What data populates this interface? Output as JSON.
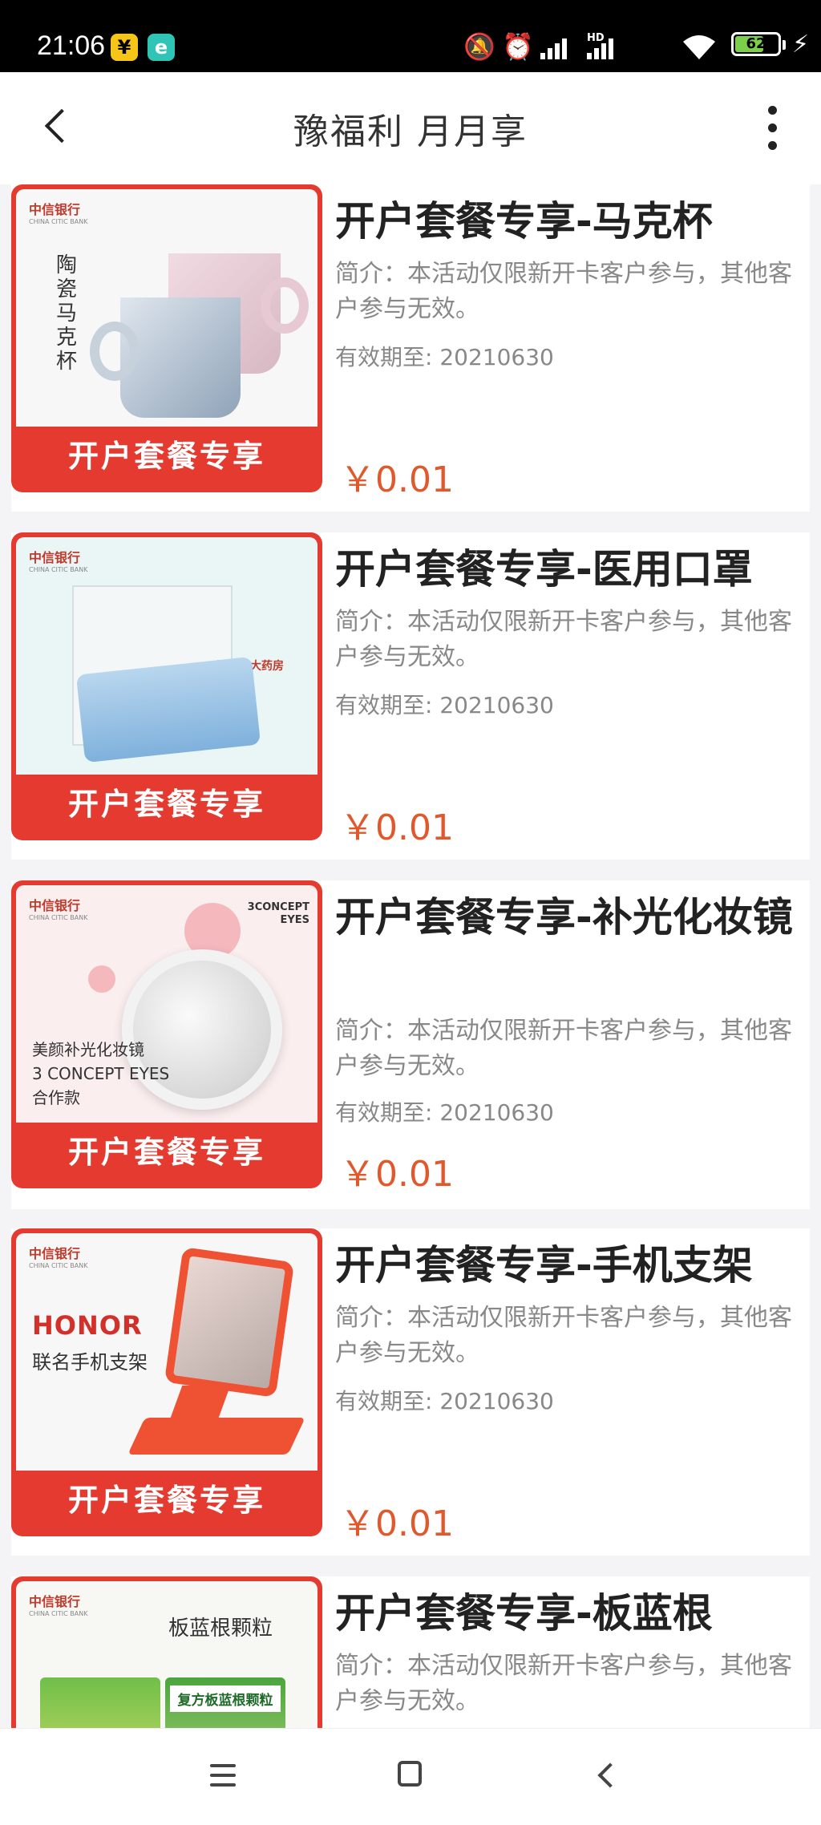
{
  "status_bar": {
    "time": "21:06",
    "app_badges": [
      "¥",
      "e"
    ],
    "network_label": "HD",
    "battery": "62"
  },
  "header": {
    "title": "豫福利 月月享"
  },
  "items": [
    {
      "title": "开户套餐专享-马克杯",
      "description": "简介：本活动仅限新开卡客户参与，其他客户参与无效。",
      "expiry": "有效期至: 20210630",
      "price": "￥0.01",
      "image_banner": "开户套餐专享",
      "image_caption": "陶瓷马克杯"
    },
    {
      "title": "开户套餐专享-医用口罩",
      "description": "简介：本活动仅限新开卡客户参与，其他客户参与无效。",
      "expiry": "有效期至: 20210630",
      "price": "￥0.01",
      "image_banner": "开户套餐专享",
      "image_caption": "张仲景大药房"
    },
    {
      "title": "开户套餐专享-补光化妆镜",
      "description": "简介：本活动仅限新开卡客户参与，其他客户参与无效。",
      "expiry": "有效期至: 20210630",
      "price": "￥0.01",
      "image_banner": "开户套餐专享",
      "image_caption": "美颜补光化妆镜\n3 CONCEPT EYES\n合作款",
      "image_brand": "3CONCEPT EYES"
    },
    {
      "title": "开户套餐专享-手机支架",
      "description": "简介：本活动仅限新开卡客户参与，其他客户参与无效。",
      "expiry": "有效期至: 20210630",
      "price": "￥0.01",
      "image_banner": "开户套餐专享",
      "image_brand": "HONOR",
      "image_caption": "联名手机支架"
    },
    {
      "title": "开户套餐专享-板蓝根",
      "description": "简介：本活动仅限新开卡客户参与，其他客户参与无效。",
      "image_caption": "板蓝根颗粒",
      "image_pack_label": "复方板蓝根颗粒"
    }
  ],
  "bank_logo": "中信银行",
  "bank_logo_en": "CHINA CITIC BANK",
  "colors": {
    "banner_red": "#e53a2f",
    "price_orange": "#e0592c",
    "status_bar": "#000000"
  },
  "nav_bar": {
    "icons": [
      "menu-icon",
      "home-icon",
      "back-icon"
    ]
  }
}
